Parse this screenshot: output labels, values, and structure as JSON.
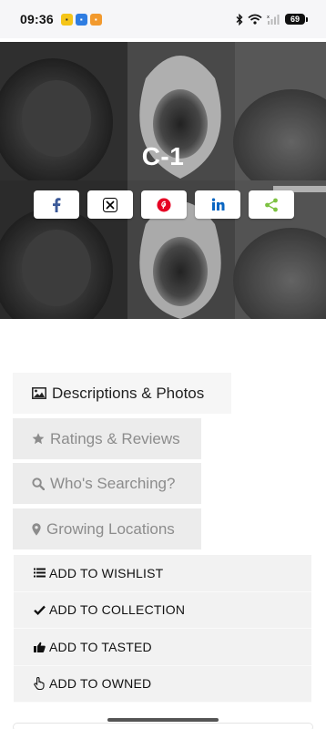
{
  "status_bar": {
    "time": "09:36",
    "battery": "69",
    "app_icons": [
      {
        "name": "yellow-app-icon",
        "color": "#f5c518"
      },
      {
        "name": "blue-app-icon",
        "color": "#2f7de1"
      },
      {
        "name": "orange-app-icon",
        "color": "#f29a2e"
      }
    ]
  },
  "hero": {
    "title": "C-1",
    "share_buttons": [
      {
        "name": "facebook",
        "color": "#3b5998"
      },
      {
        "name": "x",
        "color": "#000000"
      },
      {
        "name": "pinterest",
        "color": "#e60023"
      },
      {
        "name": "linkedin",
        "color": "#0a66c2"
      },
      {
        "name": "share",
        "color": "#7dc242"
      }
    ]
  },
  "tabs": [
    {
      "label": "Descriptions & Photos",
      "icon": "image-icon",
      "active": true
    },
    {
      "label": "Ratings & Reviews",
      "icon": "star-icon",
      "active": false
    },
    {
      "label": "Who's Searching?",
      "icon": "search-icon",
      "active": false
    },
    {
      "label": "Growing Locations",
      "icon": "map-marker-icon",
      "active": false
    }
  ],
  "actions": [
    {
      "label": "ADD TO WISHLIST",
      "icon": "list-icon"
    },
    {
      "label": "ADD TO COLLECTION",
      "icon": "check-icon"
    },
    {
      "label": "ADD TO TASTED",
      "icon": "thumbs-up-icon"
    },
    {
      "label": "ADD TO OWNED",
      "icon": "hand-pointer-icon"
    }
  ]
}
